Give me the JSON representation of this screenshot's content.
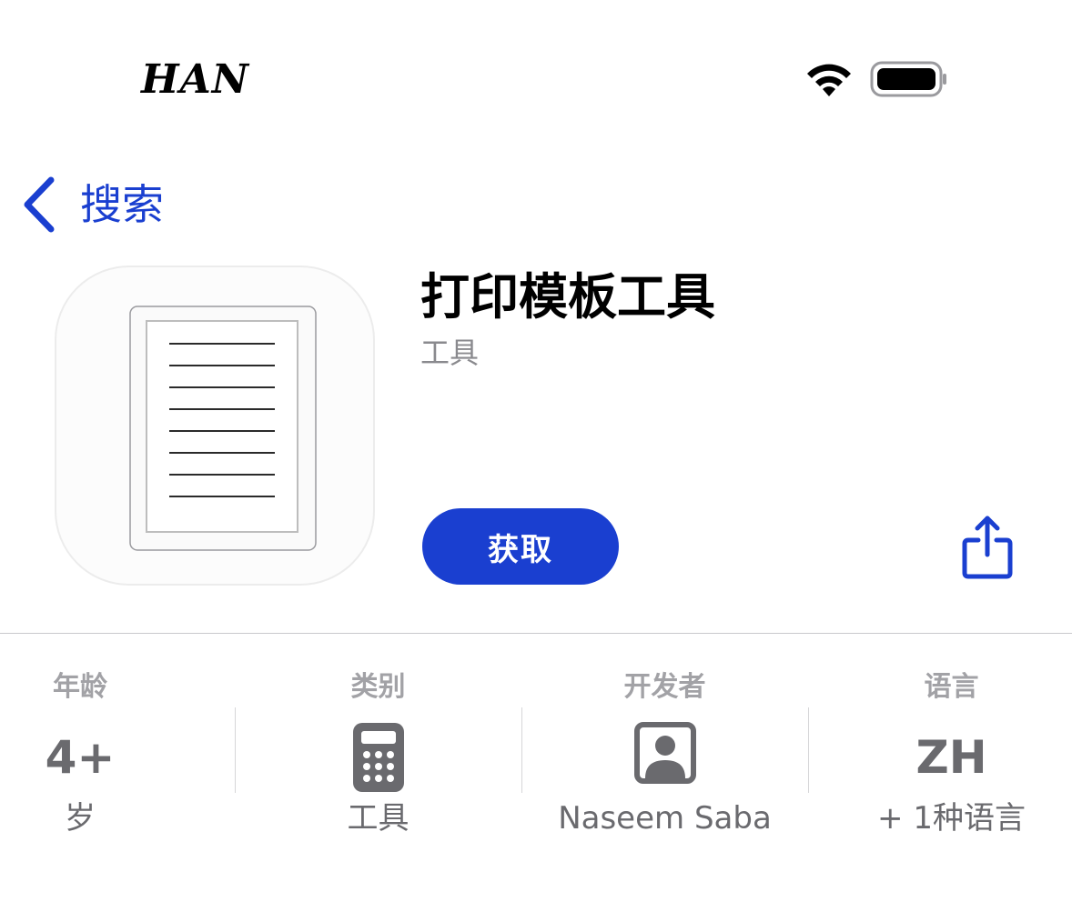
{
  "status_bar": {
    "carrier": "HAN",
    "wifi_icon": "wifi-icon",
    "battery_icon": "battery-icon"
  },
  "nav": {
    "back_label": "搜索",
    "back_icon": "chevron-left-icon"
  },
  "app": {
    "title": "打印模板工具",
    "subtitle": "工具",
    "get_label": "获取",
    "icon": "document-lines-icon",
    "share_icon": "share-icon"
  },
  "info": {
    "age": {
      "label": "年龄",
      "value": "4+",
      "sub": "岁"
    },
    "category": {
      "label": "类别",
      "icon": "calculator-icon",
      "sub": "工具"
    },
    "developer": {
      "label": "开发者",
      "icon": "person-icon",
      "sub": "Naseem Saba"
    },
    "language": {
      "label": "语言",
      "value": "ZH",
      "sub": "+ 1种语言"
    }
  },
  "colors": {
    "accent": "#1a3fd0",
    "button_bg": "#1a3fd0",
    "secondary_text": "#8a8a8e"
  }
}
